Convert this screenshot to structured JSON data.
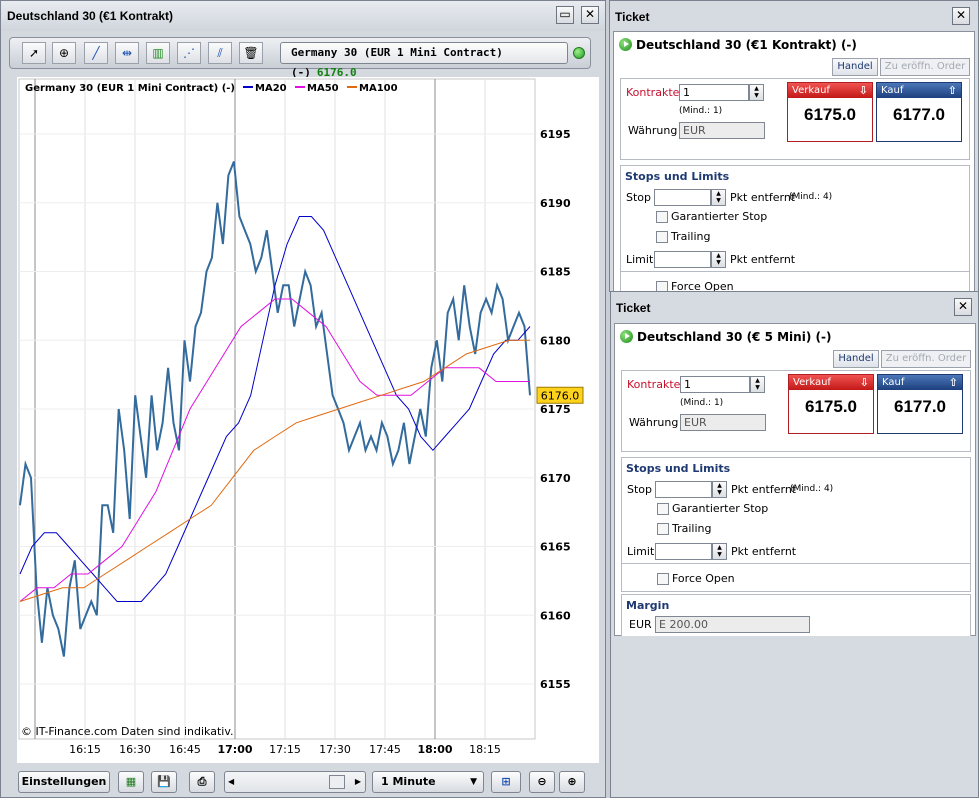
{
  "chart_window": {
    "title": "Deutschland 30 (€1 Kontrakt)",
    "instrument_name": "Germany 30 (EUR 1 Mini Contract) (-)",
    "instrument_price": "6176.0",
    "tools": [
      "pointer-icon",
      "zoom-select-icon",
      "trendline-icon",
      "horizontal-line-icon",
      "indicator-icon",
      "regression-icon",
      "fibonacci-icon",
      "trash-icon"
    ],
    "bottom": {
      "settings_label": "Einstellungen",
      "timeframe": "1 Minute"
    }
  },
  "chart_data": {
    "type": "line",
    "title": "Germany 30 (EUR 1 Mini Contract) (-)",
    "legend": [
      "MA20",
      "MA50",
      "MA100"
    ],
    "series_colors": {
      "price": "#336b9c",
      "MA20": "#0000c8",
      "MA50": "#e010e0",
      "MA100": "#e06a10"
    },
    "x_ticks": [
      "16:15",
      "16:30",
      "16:45",
      "17:00",
      "17:15",
      "17:30",
      "17:45",
      "18:00",
      "18:15"
    ],
    "x_ticks_bold": [
      "17:00",
      "18:00"
    ],
    "y_ticks": [
      6155,
      6160,
      6165,
      6170,
      6175,
      6180,
      6185,
      6190,
      6195
    ],
    "ylim": [
      6151,
      6199
    ],
    "current_price_label": "6176.0",
    "watermark": "© IT-Finance.com Daten sind indikativ.",
    "series": [
      {
        "name": "Price",
        "values": [
          6168,
          6171,
          6170,
          6162,
          6158,
          6162,
          6160,
          6159,
          6157,
          6162,
          6164,
          6159,
          6160,
          6161,
          6160,
          6168,
          6168,
          6166,
          6175,
          6172,
          6167,
          6176,
          6173,
          6170,
          6176,
          6172,
          6174,
          6178,
          6174,
          6172,
          6180,
          6177,
          6181,
          6182,
          6185,
          6186,
          6190,
          6187,
          6192,
          6193,
          6189,
          6188,
          6187,
          6185,
          6186,
          6188,
          6185,
          6182,
          6184,
          6184,
          6181,
          6183,
          6185,
          6184,
          6181,
          6182,
          6179,
          6176,
          6175,
          6174,
          6172,
          6173,
          6174,
          6172,
          6173,
          6172,
          6174,
          6173,
          6171,
          6172,
          6174,
          6171,
          6173,
          6175,
          6173,
          6178,
          6180,
          6177,
          6182,
          6183,
          6180,
          6184,
          6181,
          6179,
          6182,
          6183,
          6182,
          6184,
          6183,
          6180,
          6181,
          6182,
          6181,
          6176
        ]
      },
      {
        "name": "MA20",
        "values": [
          6163,
          6165,
          6166,
          6166,
          6165,
          6164,
          6163,
          6162,
          6161,
          6161,
          6161,
          6162,
          6163,
          6165,
          6167,
          6169,
          6171,
          6173,
          6174,
          6176,
          6180,
          6184,
          6187,
          6189,
          6189,
          6188,
          6186,
          6184,
          6182,
          6180,
          6178,
          6176,
          6175,
          6173,
          6172,
          6173,
          6174,
          6175,
          6177,
          6179,
          6180,
          6180,
          6181
        ]
      },
      {
        "name": "MA50",
        "values": [
          6161,
          6162,
          6162,
          6163,
          6163,
          6164,
          6165,
          6167,
          6169,
          6172,
          6175,
          6177,
          6179,
          6181,
          6182,
          6183,
          6183,
          6182,
          6181,
          6179,
          6177,
          6176,
          6176,
          6176,
          6177,
          6178,
          6178,
          6178,
          6177,
          6177,
          6177
        ]
      },
      {
        "name": "MA100",
        "values": [
          6161,
          6161.5,
          6162,
          6162,
          6163,
          6164,
          6165,
          6166,
          6167,
          6168,
          6170,
          6172,
          6173,
          6174,
          6174.5,
          6175,
          6175.5,
          6176,
          6176.5,
          6177,
          6178,
          6179,
          6179.5,
          6180,
          6180
        ]
      }
    ]
  },
  "ticket_1": {
    "window_title": "Ticket",
    "instrument": "Deutschland 30 (€1 Kontrakt) (-)",
    "tab_trade": "Handel",
    "tab_order": "Zu eröffn. Order",
    "contracts_label": "Kontrakte",
    "contracts_value": "1",
    "min_label": "(Mind.: 1)",
    "currency_label": "Währung",
    "currency_value": "EUR",
    "sell_label": "Verkauf",
    "sell_price": "6175.0",
    "buy_label": "Kauf",
    "buy_price": "6177.0",
    "stops_title": "Stops und Limits",
    "stop_label": "Stop",
    "stop_suffix": "Pkt entfernt",
    "stop_min": "(Mind.: 4)",
    "guaranteed_stop": "Garantierter Stop",
    "trailing": "Trailing",
    "limit_label": "Limit",
    "limit_suffix": "Pkt entfernt",
    "force_open": "Force Open"
  },
  "ticket_2": {
    "window_title": "Ticket",
    "instrument": "Deutschland 30 (€ 5 Mini) (-)",
    "tab_trade": "Handel",
    "tab_order": "Zu eröffn. Order",
    "contracts_label": "Kontrakte",
    "contracts_value": "1",
    "min_label": "(Mind.: 1)",
    "currency_label": "Währung",
    "currency_value": "EUR",
    "sell_label": "Verkauf",
    "sell_price": "6175.0",
    "buy_label": "Kauf",
    "buy_price": "6177.0",
    "stops_title": "Stops und Limits",
    "stop_label": "Stop",
    "stop_suffix": "Pkt entfernt",
    "stop_min": "(Mind.: 4)",
    "guaranteed_stop": "Garantierter Stop",
    "trailing": "Trailing",
    "limit_label": "Limit",
    "limit_suffix": "Pkt entfernt",
    "force_open": "Force Open",
    "margin_title": "Margin",
    "margin_currency": "EUR",
    "margin_value": "E 200.00"
  }
}
